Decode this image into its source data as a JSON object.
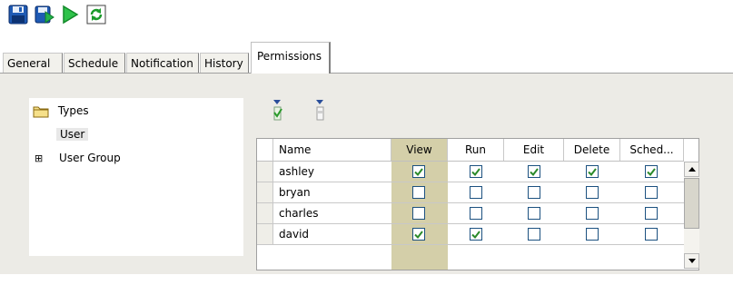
{
  "toolbar": {
    "save_icon": "save-icon",
    "save_as_icon": "save-as-icon",
    "run_icon": "run-icon",
    "refresh_icon": "refresh-icon"
  },
  "tabs": [
    {
      "label": "General"
    },
    {
      "label": "Schedule"
    },
    {
      "label": "Notification"
    },
    {
      "label": "History"
    },
    {
      "label": "Permissions",
      "active": true
    }
  ],
  "tree": {
    "types_label": "Types",
    "user_label": "User",
    "user_group_label": "User Group",
    "expand_glyph": "⊞"
  },
  "grid": {
    "headers": {
      "name": "Name",
      "view": "View",
      "run": "Run",
      "edit": "Edit",
      "delete": "Delete",
      "sched": "Sched..."
    },
    "rows": [
      {
        "name": "ashley",
        "view": true,
        "run": true,
        "edit": true,
        "delete": true,
        "sched": true
      },
      {
        "name": "bryan",
        "view": false,
        "run": false,
        "edit": false,
        "delete": false,
        "sched": false
      },
      {
        "name": "charles",
        "view": false,
        "run": false,
        "edit": false,
        "delete": false,
        "sched": false
      },
      {
        "name": "david",
        "view": true,
        "run": true,
        "edit": false,
        "delete": false,
        "sched": false
      }
    ]
  },
  "colors": {
    "accent": "#1c5180",
    "check": "#2a8a2a",
    "view_column": "#d4cfa9",
    "panel": "#ecebe6"
  }
}
